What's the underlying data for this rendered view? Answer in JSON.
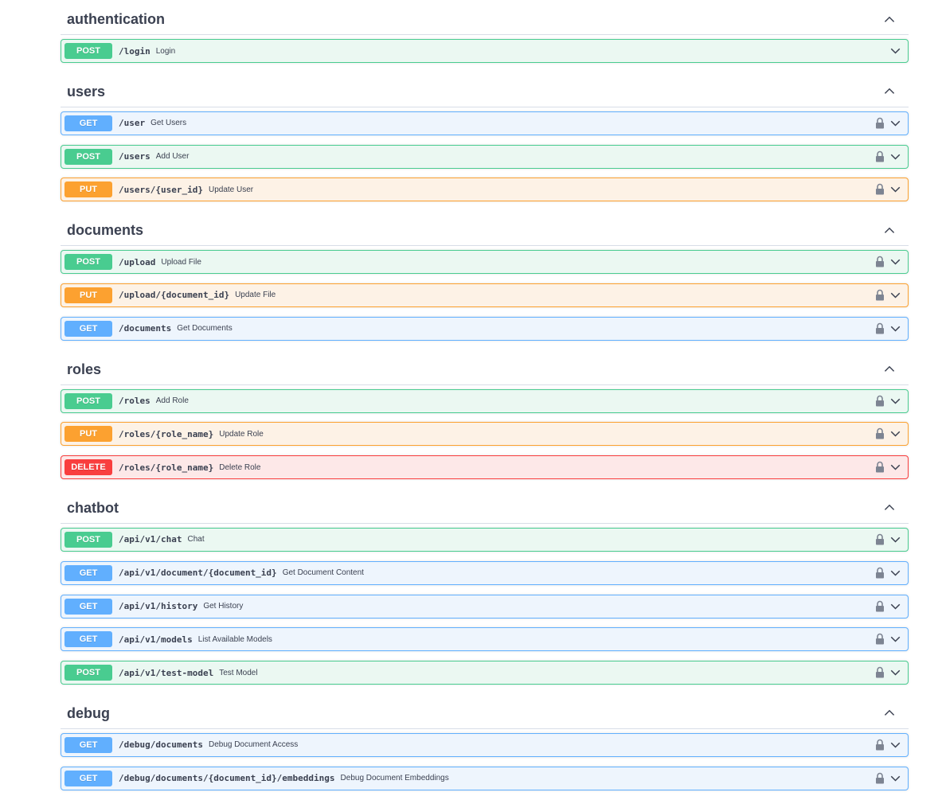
{
  "sections": [
    {
      "name": "authentication",
      "ops": [
        {
          "method": "POST",
          "path": "/login",
          "summary": "Login",
          "locked": false
        }
      ]
    },
    {
      "name": "users",
      "ops": [
        {
          "method": "GET",
          "path": "/user",
          "summary": "Get Users",
          "locked": true
        },
        {
          "method": "POST",
          "path": "/users",
          "summary": "Add User",
          "locked": true
        },
        {
          "method": "PUT",
          "path": "/users/{user_id}",
          "summary": "Update User",
          "locked": true
        }
      ]
    },
    {
      "name": "documents",
      "ops": [
        {
          "method": "POST",
          "path": "/upload",
          "summary": "Upload File",
          "locked": true
        },
        {
          "method": "PUT",
          "path": "/upload/{document_id}",
          "summary": "Update File",
          "locked": true
        },
        {
          "method": "GET",
          "path": "/documents",
          "summary": "Get Documents",
          "locked": true
        }
      ]
    },
    {
      "name": "roles",
      "ops": [
        {
          "method": "POST",
          "path": "/roles",
          "summary": "Add Role",
          "locked": true
        },
        {
          "method": "PUT",
          "path": "/roles/{role_name}",
          "summary": "Update Role",
          "locked": true
        },
        {
          "method": "DELETE",
          "path": "/roles/{role_name}",
          "summary": "Delete Role",
          "locked": true
        }
      ]
    },
    {
      "name": "chatbot",
      "ops": [
        {
          "method": "POST",
          "path": "/api/v1/chat",
          "summary": "Chat",
          "locked": true
        },
        {
          "method": "GET",
          "path": "/api/v1/document/{document_id}",
          "summary": "Get Document Content",
          "locked": true
        },
        {
          "method": "GET",
          "path": "/api/v1/history",
          "summary": "Get History",
          "locked": true
        },
        {
          "method": "GET",
          "path": "/api/v1/models",
          "summary": "List Available Models",
          "locked": true
        },
        {
          "method": "POST",
          "path": "/api/v1/test-model",
          "summary": "Test Model",
          "locked": true
        }
      ]
    },
    {
      "name": "debug",
      "ops": [
        {
          "method": "GET",
          "path": "/debug/documents",
          "summary": "Debug Document Access",
          "locked": true
        },
        {
          "method": "GET",
          "path": "/debug/documents/{document_id}/embeddings",
          "summary": "Debug Document Embeddings",
          "locked": true
        }
      ]
    }
  ],
  "icons": {
    "collapse": "chevron-up-icon",
    "expand": "chevron-down-icon",
    "lock": "lock-icon"
  },
  "colors": {
    "post": "#49cc90",
    "get": "#61affe",
    "put": "#fca130",
    "delete": "#f93e3e"
  }
}
